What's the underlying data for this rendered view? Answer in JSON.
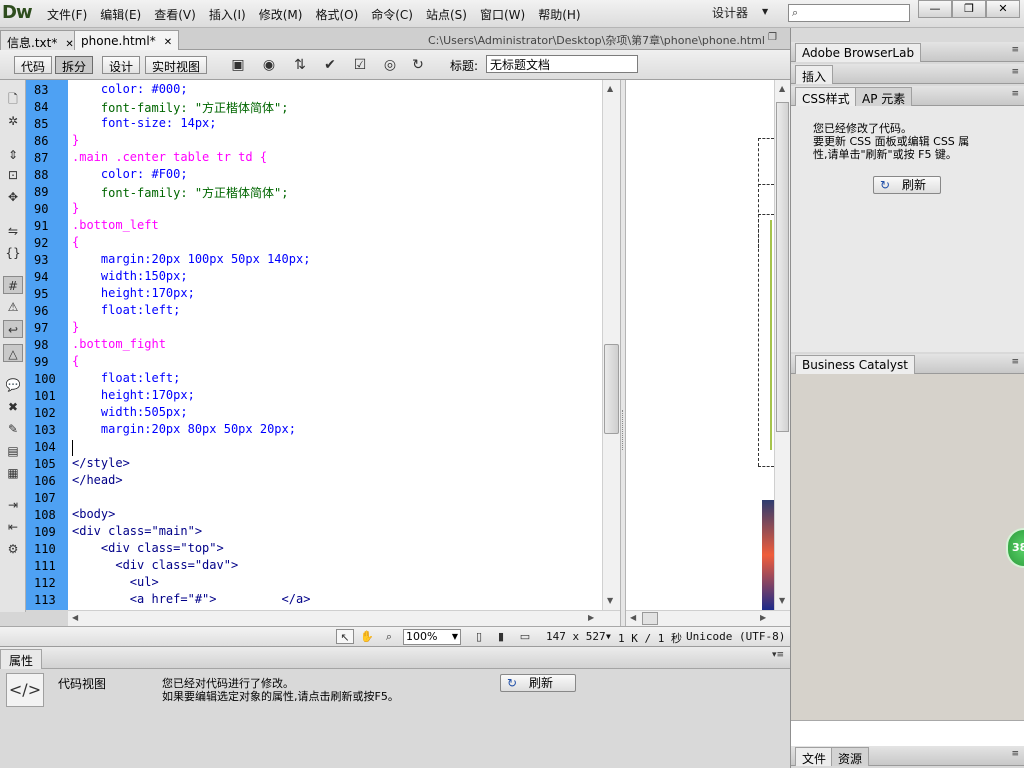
{
  "app": {
    "logo": "Dw"
  },
  "menubar": {
    "items": [
      "文件(F)",
      "编辑(E)",
      "查看(V)",
      "插入(I)",
      "修改(M)",
      "格式(O)",
      "命令(C)",
      "站点(S)",
      "窗口(W)",
      "帮助(H)"
    ],
    "workspace": "设计器",
    "window_controls": [
      "—",
      "❐",
      "✕"
    ]
  },
  "doc_tabs": {
    "tabs": [
      {
        "label": "信息.txt*",
        "active": false
      },
      {
        "label": "phone.html*",
        "active": true
      }
    ],
    "path": "C:\\Users\\Administrator\\Desktop\\杂项\\第7章\\phone\\phone.html"
  },
  "doc_toolbar": {
    "views": [
      "代码",
      "拆分",
      "设计",
      "实时视图"
    ],
    "active_view": "拆分",
    "title_label": "标题:",
    "title_value": "无标题文档"
  },
  "code": {
    "line_numbers": [
      "83",
      "84",
      "85",
      "86",
      "87",
      "88",
      "89",
      "90",
      "91",
      "92",
      "93",
      "94",
      "95",
      "96",
      "97",
      "98",
      "99",
      "100",
      "101",
      "102",
      "103",
      "104",
      "105",
      "106",
      "107",
      "108",
      "109",
      "110",
      "111",
      "112",
      "113"
    ],
    "lines": [
      "    color: #000;",
      "    font-family: \"方正楷体简体\";",
      "    font-size: 14px;",
      "}",
      ".main .center table tr td {",
      "    color: #F00;",
      "    font-family: \"方正楷体简体\";",
      "}",
      ".bottom_left",
      "{",
      "    margin:20px 100px 50px 140px;",
      "    width:150px;",
      "    height:170px;",
      "    float:left;",
      "}",
      ".bottom_fight",
      "{",
      "    float:left;",
      "    height:170px;",
      "    width:505px;",
      "    margin:20px 80px 50px 20px;",
      "",
      "</style>",
      "</head>",
      "",
      "<body>",
      "<div class=\"main\">",
      "    <div class=\"top\">",
      "      <div class=\"dav\">",
      "        <ul>",
      "        <a href=\"#\">         </a>"
    ]
  },
  "statusbar": {
    "zoom": "100%",
    "dimensions": "147 x 527",
    "size_time": "1 K / 1 秒",
    "encoding": "Unicode (UTF-8)"
  },
  "properties": {
    "tab": "属性",
    "label": "代码视图",
    "message_line1": "您已经对代码进行了修改。",
    "message_line2": "如果要编辑选定对象的属性,请点击刷新或按F5。",
    "refresh_label": "刷新"
  },
  "right_panel": {
    "browserlab_tab": "Adobe BrowserLab",
    "insert_tab": "插入",
    "css_tab": "CSS样式",
    "ap_tab": "AP 元素",
    "css_message_lines": [
      "您已经修改了代码。",
      "要更新 CSS 面板或编辑 CSS 属",
      "性,请单击\"刷新\"或按 F5 键。"
    ],
    "css_refresh_label": "刷新",
    "bc_tab": "Business Catalyst",
    "files_tab": "文件",
    "assets_tab": "资源"
  },
  "badge": {
    "value": "38"
  },
  "colors": {
    "gutter": "#4ea1f3",
    "selector": "#ff00ff",
    "property": "#0000ff",
    "string": "#006600",
    "tag": "#000088"
  }
}
